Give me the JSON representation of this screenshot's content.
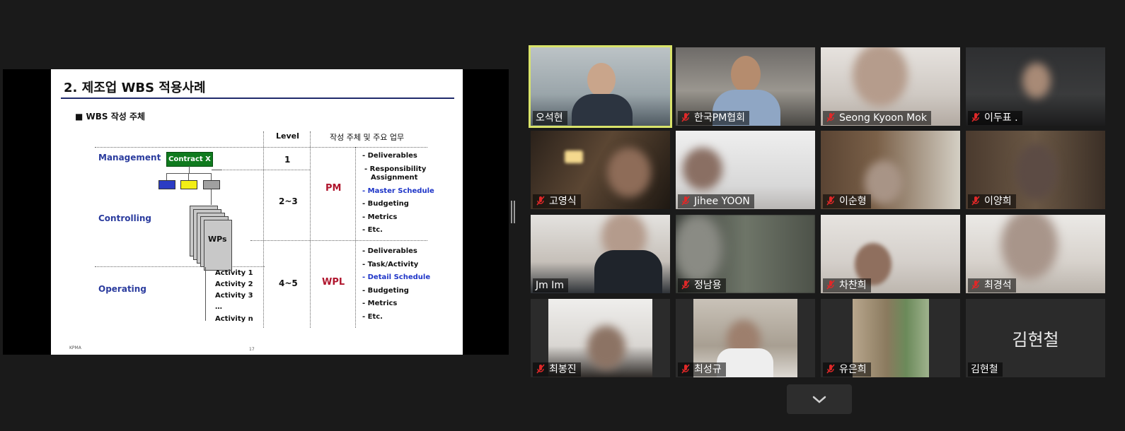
{
  "slide": {
    "title": "2. 제조업 WBS 적용사례",
    "bullet": "■  WBS 작성 주체",
    "header_level": "Level",
    "header_role": "작성 주체 및 주요 업무",
    "contract": "Contract X",
    "wps": "WPs",
    "categories": [
      "Management",
      "Controlling",
      "Operating"
    ],
    "levels": [
      "1",
      "2~3",
      "4~5"
    ],
    "roles": [
      "PM",
      "WPL"
    ],
    "pm_duties": [
      "- Deliverables",
      "- Responsibility",
      "Assignment",
      "- Master Schedule",
      "- Budgeting",
      "- Metrics",
      "- Etc."
    ],
    "wpl_duties": [
      "- Deliverables",
      "- Task/Activity",
      "- Detail Schedule",
      "- Budgeting",
      "- Metrics",
      "- Etc."
    ],
    "activities": [
      "Activity 1",
      "Activity 2",
      "Activity 3",
      "…",
      "Activity n"
    ],
    "footer_left": "KPMA",
    "page_number": "17",
    "colors": {
      "title_rule": "#1f2a6b",
      "category": "#2b3c9e",
      "role": "#b0162e",
      "highlight": "#1f36c8",
      "contract": "#0f7a1e",
      "box_blue": "#2b3cc4",
      "box_yellow": "#f2ee15",
      "box_gray": "#a0a0a0"
    }
  },
  "participants": [
    {
      "name": "오석현",
      "muted": false,
      "active": true
    },
    {
      "name": "한국PM협회",
      "muted": true
    },
    {
      "name": "Seong Kyoon Mok",
      "muted": true
    },
    {
      "name": "이두표 .",
      "muted": true
    },
    {
      "name": "고영식",
      "muted": true
    },
    {
      "name": "Jihee YOON",
      "muted": true
    },
    {
      "name": "이순형",
      "muted": true
    },
    {
      "name": "이양희",
      "muted": true
    },
    {
      "name": "Jm Im",
      "muted": false
    },
    {
      "name": "정남용",
      "muted": true
    },
    {
      "name": "차찬희",
      "muted": true
    },
    {
      "name": "최경석",
      "muted": true
    },
    {
      "name": "최봉진",
      "muted": true
    },
    {
      "name": "최성규",
      "muted": true
    },
    {
      "name": "유은희",
      "muted": true
    },
    {
      "name": "김현철",
      "muted": false,
      "video_off": true
    }
  ],
  "icons": {
    "muted": "mic-off-icon",
    "more": "chevron-down-icon",
    "splitter": "resize-handle-icon"
  },
  "colors": {
    "background": "#1a1a1a",
    "active_speaker": "#d9e36a",
    "muted_icon": "#e02828"
  }
}
